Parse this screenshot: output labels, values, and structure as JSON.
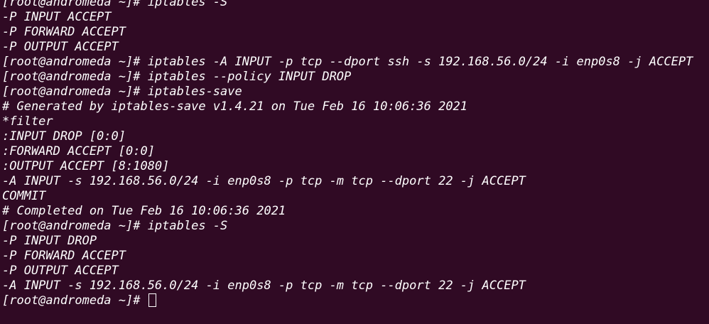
{
  "terminal": {
    "lines": [
      "[root@andromeda ~]# iptables -S",
      "-P INPUT ACCEPT",
      "-P FORWARD ACCEPT",
      "-P OUTPUT ACCEPT",
      "[root@andromeda ~]# iptables -A INPUT -p tcp --dport ssh -s 192.168.56.0/24 -i enp0s8 -j ACCEPT",
      "[root@andromeda ~]# iptables --policy INPUT DROP",
      "[root@andromeda ~]# iptables-save",
      "# Generated by iptables-save v1.4.21 on Tue Feb 16 10:06:36 2021",
      "*filter",
      ":INPUT DROP [0:0]",
      ":FORWARD ACCEPT [0:0]",
      ":OUTPUT ACCEPT [8:1080]",
      "-A INPUT -s 192.168.56.0/24 -i enp0s8 -p tcp -m tcp --dport 22 -j ACCEPT",
      "COMMIT",
      "# Completed on Tue Feb 16 10:06:36 2021",
      "[root@andromeda ~]# iptables -S",
      "-P INPUT DROP",
      "-P FORWARD ACCEPT",
      "-P OUTPUT ACCEPT",
      "-A INPUT -s 192.168.56.0/24 -i enp0s8 -p tcp -m tcp --dport 22 -j ACCEPT"
    ],
    "prompt": "[root@andromeda ~]# "
  },
  "colors": {
    "background": "#300a24",
    "foreground": "#ffffff"
  }
}
